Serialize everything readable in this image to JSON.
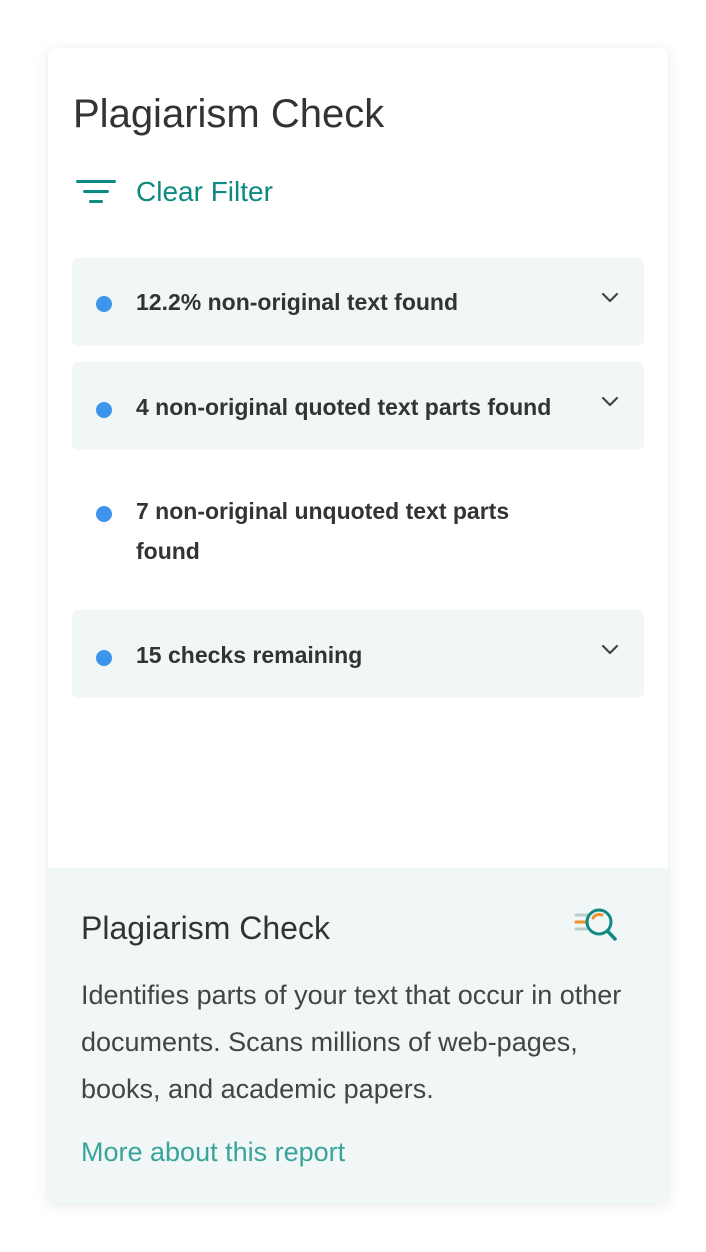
{
  "panel": {
    "title": "Plagiarism Check",
    "filter_label": "Clear Filter",
    "filter_icon": "filter-lines-icon"
  },
  "results": [
    {
      "label": "12.2% non-original text found",
      "expandable": true
    },
    {
      "label": "4 non-original quoted text parts found",
      "expandable": true
    },
    {
      "label": "7 non-original unquoted text parts found",
      "expandable": false
    },
    {
      "label": "15 checks remaining",
      "expandable": true
    }
  ],
  "info": {
    "title": "Plagiarism Check",
    "icon": "plagiarism-search-icon",
    "description": "Identifies parts of your text that occur in other documents. Scans millions of web-pages, books, and academic papers.",
    "link": "More about this report"
  },
  "colors": {
    "accent": "#0e8a82",
    "link": "#3aa39a",
    "bullet": "#3d94ea",
    "row_background": "#f0f7f6",
    "icon_orange": "#f0922f"
  }
}
